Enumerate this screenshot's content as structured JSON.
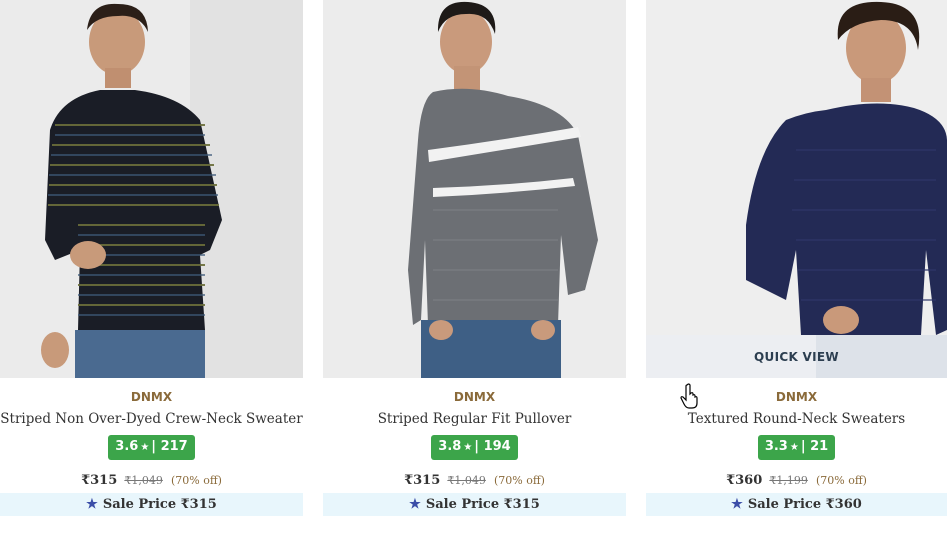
{
  "products": [
    {
      "brand": "DNMX",
      "name": "Striped Non Over-Dyed Crew-Neck Sweater",
      "rating": "3.6",
      "rating_count": "217",
      "price": "₹315",
      "mrp": "₹1,049",
      "discount": "(70% off)",
      "sale_label": "Sale Price ₹315",
      "image_icon": "model-photo-black-striped-sweater"
    },
    {
      "brand": "DNMX",
      "name": "Striped Regular Fit Pullover",
      "rating": "3.8",
      "rating_count": "194",
      "price": "₹315",
      "mrp": "₹1,049",
      "discount": "(70% off)",
      "sale_label": "Sale Price ₹315",
      "image_icon": "model-photo-grey-striped-pullover"
    },
    {
      "brand": "DNMX",
      "name": "Textured Round-Neck Sweaters",
      "rating": "3.3",
      "rating_count": "21",
      "price": "₹360",
      "mrp": "₹1,199",
      "discount": "(70% off)",
      "sale_label": "Sale Price ₹360",
      "quick_view": "QUICK VIEW",
      "image_icon": "model-photo-navy-textured-sweater"
    }
  ],
  "colors": {
    "rating_bg": "#3ca54a",
    "sale_bg": "#e8f6fc",
    "brand": "#8a6a3a",
    "star": "#3b4ea8"
  }
}
